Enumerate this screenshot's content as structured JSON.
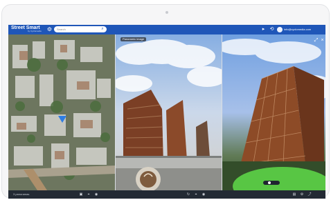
{
  "app": {
    "name": "Street Smart",
    "subtitle": "by Cyclomedia",
    "search_placeholder": "Search",
    "user": "info@cyclomedia.com"
  },
  "panes": {
    "street_label": "Panoramic image",
    "bottom_status": "3 panoramas"
  },
  "icons": {
    "gear": "⚙",
    "search": "⌕",
    "arrow": "▸",
    "share": "⟲",
    "expand": "⤢",
    "close": "×"
  },
  "colors": {
    "brand": "#1f56b8",
    "dark": "#232a34"
  }
}
